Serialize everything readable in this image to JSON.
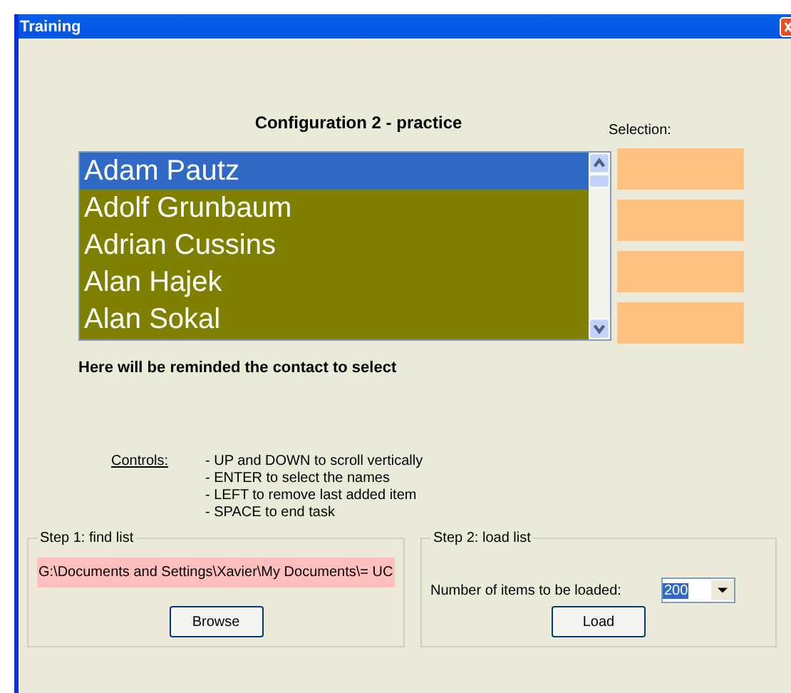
{
  "window": {
    "title": "Training"
  },
  "heading": "Configuration 2 - practice",
  "names": {
    "items": [
      {
        "label": "Adam Pautz",
        "selected": true
      },
      {
        "label": "Adolf Grunbaum",
        "selected": false
      },
      {
        "label": "Adrian Cussins",
        "selected": false
      },
      {
        "label": "Alan Hajek",
        "selected": false
      },
      {
        "label": "Alan Sokal",
        "selected": false
      }
    ]
  },
  "selection": {
    "label": "Selection:",
    "slots": [
      {
        "kind": "empty"
      },
      {
        "kind": "empty"
      },
      {
        "kind": "empty"
      },
      {
        "kind": "empty"
      }
    ]
  },
  "reminder": "Here will be reminded the contact to select",
  "controls": {
    "label": "Controls:",
    "lines": [
      "- UP and DOWN to scroll vertically",
      "- ENTER to select the names",
      "- LEFT to remove last added item",
      "- SPACE to end task"
    ]
  },
  "step1": {
    "title": "Step 1: find list",
    "path": "G:\\Documents and Settings\\Xavier\\My Documents\\= UC",
    "button": "Browse"
  },
  "step2": {
    "title": "Step 2: load list",
    "label": "Number of items to be loaded:",
    "combo": {
      "value": "200",
      "selected": true
    },
    "button": "Load"
  }
}
